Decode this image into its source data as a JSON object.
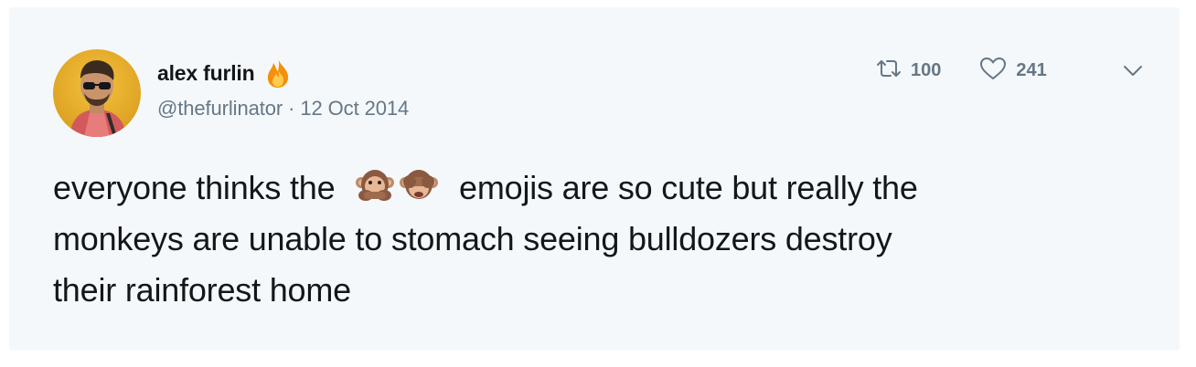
{
  "tweet": {
    "display_name": "alex furlin",
    "handle": "@thefurlinator",
    "separator": " · ",
    "date": "12 Oct 2014",
    "retweet_count": "100",
    "like_count": "241",
    "text_part1": "everyone thinks the",
    "text_part2": "emojis are so cute but really the",
    "text_line2": "monkeys are unable to stomach seeing bulldozers destroy",
    "text_line3": "their rainforest home",
    "emojis": [
      "speak-no-evil-monkey",
      "see-no-evil-monkey"
    ],
    "name_emoji": "fire"
  },
  "colors": {
    "card_bg": "#f5f8fa",
    "text": "#14171a",
    "muted": "#657786"
  }
}
